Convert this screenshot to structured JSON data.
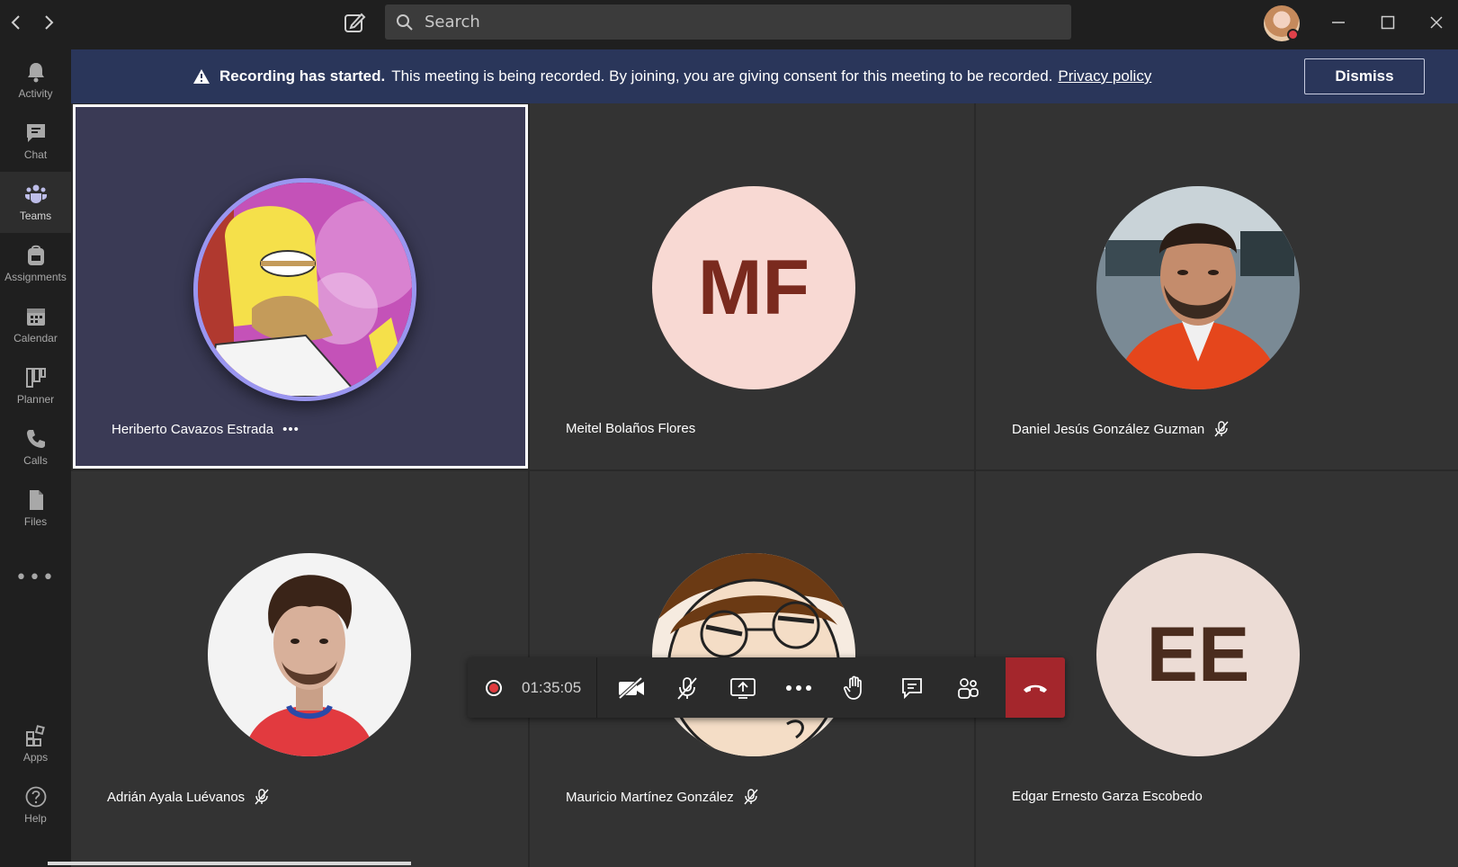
{
  "titlebar": {
    "search_placeholder": "Search"
  },
  "rail": {
    "items": [
      {
        "label": "Activity",
        "icon": "bell-icon"
      },
      {
        "label": "Chat",
        "icon": "chat-icon"
      },
      {
        "label": "Teams",
        "icon": "teams-icon"
      },
      {
        "label": "Assignments",
        "icon": "backpack-icon"
      },
      {
        "label": "Calendar",
        "icon": "calendar-icon"
      },
      {
        "label": "Planner",
        "icon": "planner-icon"
      },
      {
        "label": "Calls",
        "icon": "phone-icon"
      },
      {
        "label": "Files",
        "icon": "file-icon"
      }
    ],
    "more": "•••",
    "apps_label": "Apps",
    "help_label": "Help"
  },
  "banner": {
    "title": "Recording has started.",
    "message": "This meeting is being recorded. By joining, you are giving consent for this meeting to be recorded.",
    "link": "Privacy policy",
    "dismiss_label": "Dismiss"
  },
  "participants": [
    {
      "name": "Heriberto Cavazos Estrada",
      "more": "•••"
    },
    {
      "name": "Meitel Bolaños Flores",
      "initials": "MF"
    },
    {
      "name": "Daniel Jesús González Guzman"
    },
    {
      "name": "Adrián Ayala Luévanos"
    },
    {
      "name": "Mauricio Martínez González"
    },
    {
      "name": "Edgar Ernesto Garza Escobedo",
      "initials": "EE"
    }
  ],
  "controls": {
    "timer": "01:35:05"
  },
  "colors": {
    "banner_bg": "#2a365a",
    "hangup": "#a4262c",
    "mf_bg": "#f8d9d3",
    "mf_text": "#7a2a1e",
    "ee_bg": "#ecdcd5",
    "ee_text": "#4a2c1e",
    "speaker_ring": "#9a96f0"
  }
}
